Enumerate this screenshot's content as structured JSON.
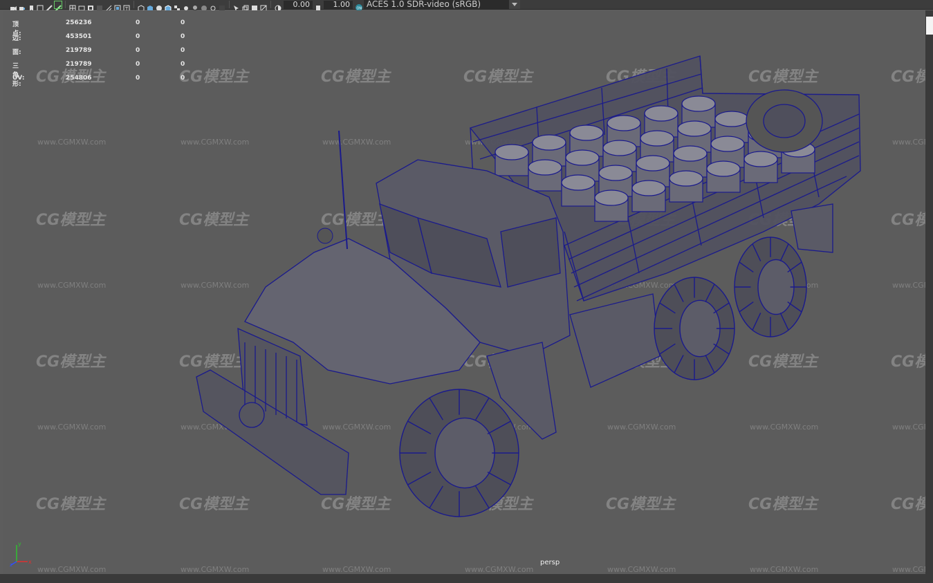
{
  "toolbar": {
    "exposure_value": "0.00",
    "gamma_value": "1.00",
    "color_space": "ACES 1.0 SDR-video (sRGB)"
  },
  "hud": {
    "rows": [
      {
        "label": "顶点:",
        "v1": "256236",
        "v2": "0",
        "v3": "0"
      },
      {
        "label": "边:",
        "v1": "453501",
        "v2": "0",
        "v3": "0"
      },
      {
        "label": "面:",
        "v1": "219789",
        "v2": "0",
        "v3": "0"
      },
      {
        "label": "三角形:",
        "v1": "219789",
        "v2": "0",
        "v3": "0"
      },
      {
        "label": "UV:",
        "v1": "254806",
        "v2": "0",
        "v3": "0"
      }
    ]
  },
  "viewport": {
    "camera_label": "persp",
    "wireframe_color": "#1a1a8c"
  },
  "watermark": {
    "logo_text": "CG模型主",
    "url_text": "www.CGMXW.com"
  }
}
